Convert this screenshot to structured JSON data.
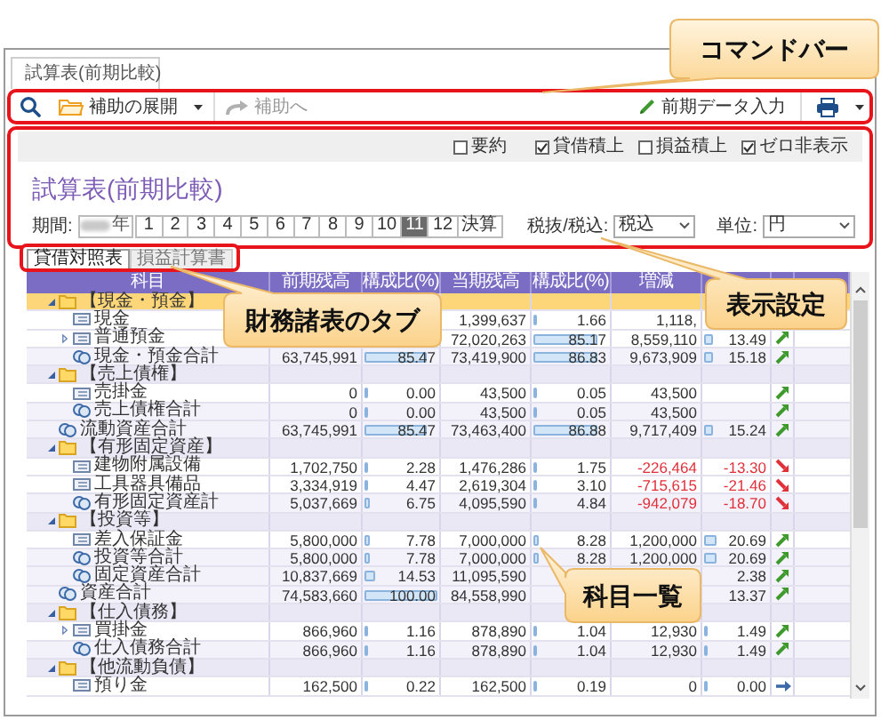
{
  "document_tab": {
    "label": "試算表(前期比較)"
  },
  "command_bar": {
    "expand_button": {
      "label": "補助の展開"
    },
    "goto_button": {
      "label": "補助へ",
      "disabled": true
    },
    "prior_data_button": {
      "label": "前期データ入力"
    }
  },
  "display_settings": {
    "options": [
      {
        "label": "要約",
        "checked": false
      },
      {
        "label": "貸借積上",
        "checked": true
      },
      {
        "label": "損益積上",
        "checked": false
      },
      {
        "label": "ゼロ非表示",
        "checked": true
      }
    ],
    "title": "試算表(前期比較)",
    "period_label": "期間:",
    "year_suffix": "年",
    "periods": [
      {
        "label": "1",
        "selected": false
      },
      {
        "label": "2",
        "selected": false
      },
      {
        "label": "3",
        "selected": false
      },
      {
        "label": "4",
        "selected": false
      },
      {
        "label": "5",
        "selected": false
      },
      {
        "label": "6",
        "selected": false
      },
      {
        "label": "7",
        "selected": false
      },
      {
        "label": "8",
        "selected": false
      },
      {
        "label": "9",
        "selected": false
      },
      {
        "label": "10",
        "selected": false
      },
      {
        "label": "11",
        "selected": true
      },
      {
        "label": "12",
        "selected": false
      },
      {
        "label": "決算",
        "selected": false
      }
    ],
    "tax_label": "税抜/税込:",
    "tax_value": "税込",
    "unit_label": "単位:",
    "unit_value": "円"
  },
  "statement_tabs": [
    {
      "label": "貸借対照表",
      "selected": true
    },
    {
      "label": "損益計算書",
      "selected": false
    }
  ],
  "table": {
    "columns": [
      "科目",
      "前期残高",
      "構成比(%)",
      "当期残高",
      "構成比(%)",
      "増減"
    ],
    "rows": [
      {
        "kind": "group",
        "label": "【現金・預金】",
        "expanded": true,
        "selected": true,
        "children": [
          {
            "kind": "account",
            "label": "現金",
            "selected": false,
            "cur_amount": "1,399,637",
            "cur_ratio": {
              "text": "1.66",
              "level": 0.0166
            },
            "diff": "1,118,",
            "negative": false
          },
          {
            "kind": "account",
            "label": "普通預金",
            "expanded": false,
            "selected": false,
            "cur_amount": "72,020,263",
            "cur_ratio": {
              "text": "85.17",
              "level": 0.8517
            },
            "diff": "8,559,110",
            "diff_ratio": {
              "text": "13.49",
              "level": 0.1349
            },
            "negative": false,
            "trend_icon": {
              "kind": "up"
            }
          },
          {
            "kind": "subtotal",
            "label": "現金・預金合計",
            "selected": false,
            "prev_amount": "63,745,991",
            "prev_ratio": {
              "text": "85.47",
              "level": 0.8547
            },
            "cur_amount": "73,419,900",
            "cur_ratio": {
              "text": "86.83",
              "level": 0.8683
            },
            "diff": "9,673,909",
            "diff_ratio": {
              "text": "15.18",
              "level": 0.1518
            },
            "negative": false,
            "trend_icon": {
              "kind": "up"
            }
          }
        ]
      },
      {
        "kind": "group",
        "label": "【売上債権】",
        "expanded": true,
        "selected": false,
        "children": [
          {
            "kind": "account",
            "label": "売掛金",
            "selected": false,
            "prev_amount": "0",
            "prev_ratio": {
              "text": "0.00",
              "level": 0
            },
            "cur_amount": "43,500",
            "cur_ratio": {
              "text": "0.05",
              "level": 0.0005
            },
            "diff": "43,500",
            "negative": false,
            "trend_icon": {
              "kind": "up"
            }
          },
          {
            "kind": "subtotal",
            "label": "売上債権合計",
            "selected": false,
            "prev_amount": "0",
            "prev_ratio": {
              "text": "0.00",
              "level": 0
            },
            "cur_amount": "43,500",
            "cur_ratio": {
              "text": "0.05",
              "level": 0.0005
            },
            "diff": "43,500",
            "negative": false,
            "trend_icon": {
              "kind": "up"
            }
          }
        ]
      },
      {
        "kind": "subtotal",
        "label": "流動資産合計",
        "selected": false,
        "prev_amount": "63,745,991",
        "prev_ratio": {
          "text": "85.47",
          "level": 0.8547
        },
        "cur_amount": "73,463,400",
        "cur_ratio": {
          "text": "86.88",
          "level": 0.8688
        },
        "diff": "9,717,409",
        "diff_ratio": {
          "text": "15.24",
          "level": 0.1524
        },
        "negative": false,
        "trend_icon": {
          "kind": "up"
        }
      },
      {
        "kind": "group",
        "label": "【有形固定資産】",
        "expanded": true,
        "selected": false,
        "children": [
          {
            "kind": "account",
            "label": "建物附属設備",
            "selected": false,
            "prev_amount": "1,702,750",
            "prev_ratio": {
              "text": "2.28",
              "level": 0.0228
            },
            "cur_amount": "1,476,286",
            "cur_ratio": {
              "text": "1.75",
              "level": 0.0175
            },
            "diff": "-226,464",
            "diff_ratio": {
              "text": "-13.30"
            },
            "negative": true,
            "trend_icon": {
              "kind": "down"
            }
          },
          {
            "kind": "account",
            "label": "工具器具備品",
            "selected": false,
            "prev_amount": "3,334,919",
            "prev_ratio": {
              "text": "4.47",
              "level": 0.0447
            },
            "cur_amount": "2,619,304",
            "cur_ratio": {
              "text": "3.10",
              "level": 0.031
            },
            "diff": "-715,615",
            "diff_ratio": {
              "text": "-21.46"
            },
            "negative": true,
            "trend_icon": {
              "kind": "down"
            }
          },
          {
            "kind": "subtotal",
            "label": "有形固定資産計",
            "selected": false,
            "prev_amount": "5,037,669",
            "prev_ratio": {
              "text": "6.75",
              "level": 0.0675
            },
            "cur_amount": "4,095,590",
            "cur_ratio": {
              "text": "4.84",
              "level": 0.0484
            },
            "diff": "-942,079",
            "diff_ratio": {
              "text": "-18.70"
            },
            "negative": true,
            "trend_icon": {
              "kind": "down"
            }
          }
        ]
      },
      {
        "kind": "group",
        "label": "【投資等】",
        "expanded": true,
        "selected": false,
        "children": [
          {
            "kind": "account",
            "label": "差入保証金",
            "selected": false,
            "prev_amount": "5,800,000",
            "prev_ratio": {
              "text": "7.78",
              "level": 0.0778
            },
            "cur_amount": "7,000,000",
            "cur_ratio": {
              "text": "8.28",
              "level": 0.0828
            },
            "diff": "1,200,000",
            "diff_ratio": {
              "text": "20.69",
              "level": 0.2069
            },
            "negative": false,
            "trend_icon": {
              "kind": "up"
            }
          },
          {
            "kind": "subtotal",
            "label": "投資等合計",
            "selected": false,
            "prev_amount": "5,800,000",
            "prev_ratio": {
              "text": "7.78",
              "level": 0.0778
            },
            "cur_amount": "7,000,000",
            "cur_ratio": {
              "text": "8.28",
              "level": 0.0828
            },
            "diff": "1,200,000",
            "diff_ratio": {
              "text": "20.69",
              "level": 0.2069
            },
            "negative": false,
            "trend_icon": {
              "kind": "up"
            }
          },
          {
            "kind": "subtotal",
            "label": "固定資産合計",
            "selected": false,
            "prev_amount": "10,837,669",
            "prev_ratio": {
              "text": "14.53",
              "level": 0.1453
            },
            "cur_amount": "11,095,590",
            "diff_ratio": {
              "text": "2.38"
            },
            "negative": false,
            "trend_icon": {
              "kind": "up"
            }
          }
        ]
      },
      {
        "kind": "subtotal",
        "label": "資産合計",
        "selected": false,
        "prev_amount": "74,583,660",
        "prev_ratio": {
          "text": "100.00",
          "level": 1
        },
        "cur_amount": "84,558,990",
        "diff_ratio": {
          "text": "13.37"
        },
        "negative": false,
        "trend_icon": {
          "kind": "up"
        }
      },
      {
        "kind": "group",
        "label": "【仕入債務】",
        "expanded": true,
        "selected": false,
        "children": [
          {
            "kind": "account",
            "label": "買掛金",
            "expanded": false,
            "selected": false,
            "prev_amount": "866,960",
            "prev_ratio": {
              "text": "1.16",
              "level": 0.0116
            },
            "cur_amount": "878,890",
            "cur_ratio": {
              "text": "1.04",
              "level": 0.0104
            },
            "diff": "12,930",
            "diff_ratio": {
              "text": "1.49",
              "level": 0.0149
            },
            "negative": false,
            "trend_icon": {
              "kind": "up"
            }
          },
          {
            "kind": "subtotal",
            "label": "仕入債務合計",
            "selected": false,
            "prev_amount": "866,960",
            "prev_ratio": {
              "text": "1.16",
              "level": 0.0116
            },
            "cur_amount": "878,890",
            "cur_ratio": {
              "text": "1.04",
              "level": 0.0104
            },
            "diff": "12,930",
            "diff_ratio": {
              "text": "1.49",
              "level": 0.0149
            },
            "negative": false,
            "trend_icon": {
              "kind": "up"
            }
          }
        ]
      },
      {
        "kind": "group",
        "label": "【他流動負債】",
        "expanded": true,
        "selected": false,
        "children": [
          {
            "kind": "account",
            "label": "預り金",
            "selected": false,
            "prev_amount": "162,500",
            "prev_ratio": {
              "text": "0.22",
              "level": 0.0022
            },
            "cur_amount": "162,500",
            "cur_ratio": {
              "text": "0.19",
              "level": 0.0019
            },
            "diff": "0",
            "diff_ratio": {
              "text": "0.00",
              "level": 0
            },
            "negative": false,
            "trend_icon": {
              "kind": "flat"
            }
          }
        ]
      }
    ]
  },
  "callouts": [
    {
      "text": "コマンドバー"
    },
    {
      "text": "表示設定"
    },
    {
      "text": "財務諸表のタブ"
    },
    {
      "text": "科目一覧"
    }
  ]
}
